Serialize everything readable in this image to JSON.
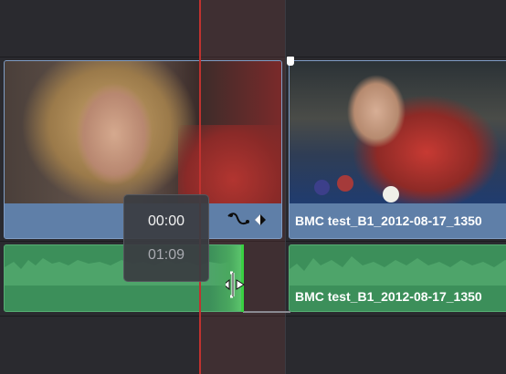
{
  "timeline": {
    "video_clips": [
      {
        "name": ""
      },
      {
        "name": "BMC test_B1_2012-08-17_1350"
      }
    ],
    "audio_clips": [
      {
        "name": ""
      },
      {
        "name": "BMC test_B1_2012-08-17_1350"
      }
    ],
    "clip_a_icons": "⟡◆",
    "trim_tooltip": {
      "timecode": "00:00",
      "duration": "01:09"
    }
  },
  "colors": {
    "video_clip": "#5f7fa8",
    "audio_clip": "#3c8f5a",
    "playhead": "#c0322f",
    "trim_edge": "#39d142"
  },
  "icons": [
    "curve-icon",
    "keyframe-diamond-icon",
    "trim-cursor-icon",
    "in-point-marker-icon"
  ]
}
